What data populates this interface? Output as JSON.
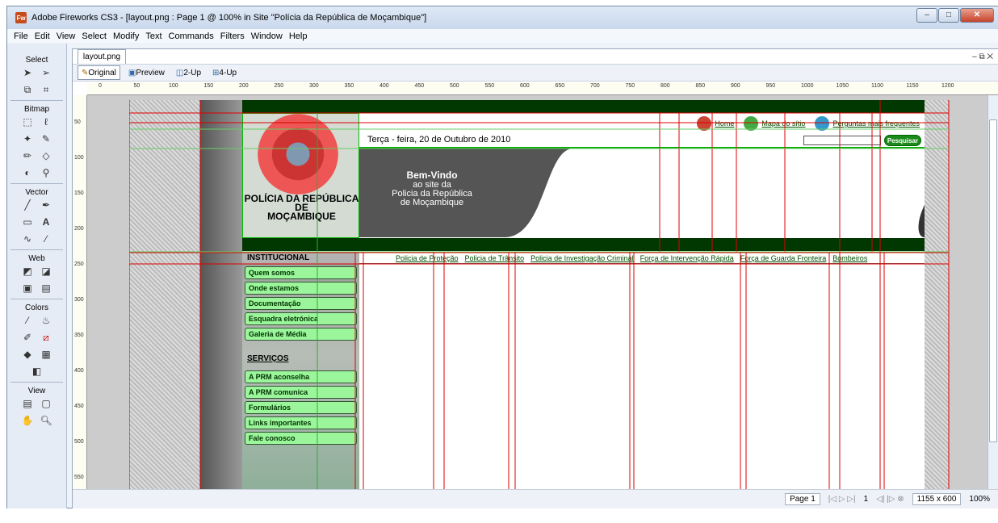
{
  "window": {
    "title": "Adobe Fireworks CS3 - [layout.png : Page 1 @ 100% in Site \"Polícia da República de Moçambique\"]",
    "app_icon": "Fw"
  },
  "menu": [
    "File",
    "Edit",
    "View",
    "Select",
    "Modify",
    "Text",
    "Commands",
    "Filters",
    "Window",
    "Help"
  ],
  "tools": {
    "select": "Select",
    "bitmap": "Bitmap",
    "vector": "Vector",
    "web": "Web",
    "colors": "Colors",
    "view": "View"
  },
  "document": {
    "tab": "layout.png"
  },
  "viewmodes": [
    {
      "label": "Original"
    },
    {
      "label": "Preview"
    },
    {
      "label": "2-Up"
    },
    {
      "label": "4-Up"
    }
  ],
  "ruler": {
    "h": [
      "0",
      "50",
      "100",
      "150",
      "200",
      "250",
      "300",
      "350",
      "400",
      "450",
      "500",
      "550",
      "600",
      "650",
      "700",
      "750",
      "800",
      "850",
      "900",
      "950",
      "1000",
      "1050",
      "1100",
      "1150",
      "1200"
    ],
    "v": [
      "50",
      "100",
      "150",
      "200",
      "250",
      "300",
      "350",
      "400",
      "450",
      "500",
      "550"
    ]
  },
  "site": {
    "logo": [
      "POLÍCIA DA REPÚBLICA",
      "DE",
      "MOÇAMBIQUE"
    ],
    "date": "Terça - feira, 20 de Outubro de 2010",
    "top_links": [
      "Home",
      "Mapa do sítio",
      "Perguntas mais frequentes"
    ],
    "search_button": "Pesquisar",
    "banner": [
      "Bem-Vindo",
      "ao site da",
      "Policia da República",
      "de Moçambique"
    ],
    "nav_header": "INSTITUCIONAL",
    "nav_links": [
      "Policia de Proteção",
      "Policia de Trânsito",
      "Policia de Investigação Criminal",
      "Força de Intervenção Rápida",
      "Força de Guarda Fronteira",
      "Bombeiros"
    ],
    "menu1": [
      "Quem somos",
      "Onde estamos",
      "Documentação",
      "Esquadra eletrónica",
      "Galeria de Média"
    ],
    "section2": "SERVIÇOS",
    "menu2": [
      "A PRM aconselha",
      "A PRM comunica",
      "Formulários",
      "Links importantes",
      "Fale conosco"
    ]
  },
  "status": {
    "page": "Page 1",
    "frame": "1",
    "size": "1155 x 600",
    "zoom": "100%"
  }
}
